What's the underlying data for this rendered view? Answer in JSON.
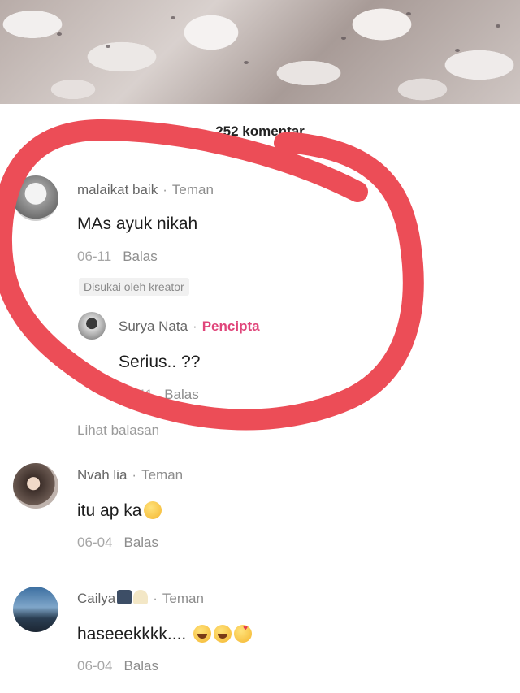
{
  "comments_header": {
    "count_text": "252 komentar"
  },
  "comments": [
    {
      "name": "malaikat baik",
      "relation": "Teman",
      "text": "MAs ayuk nikah",
      "date": "06-11",
      "reply_label": "Balas",
      "liked_badge": "Disukai oleh kreator",
      "reply": {
        "name": "Surya Nata",
        "relation": "Pencipta",
        "text": "Serius.. ??",
        "date": "06-11",
        "reply_label": "Balas"
      },
      "view_replies": "Lihat balasan"
    },
    {
      "name": "Nvah lia",
      "relation": "Teman",
      "text": "itu ap ka",
      "date": "06-04",
      "reply_label": "Balas"
    },
    {
      "name": "Cailya",
      "relation": "Teman",
      "text": "haseeekkkk....",
      "date": "06-04",
      "reply_label": "Balas"
    }
  ],
  "colors": {
    "creator_tag": "#e0457a",
    "annotation_stroke": "#ec4d57"
  },
  "icons": [
    "laughing-emoji-icon",
    "smiling-emoji-icon",
    "heart-face-emoji-icon"
  ]
}
